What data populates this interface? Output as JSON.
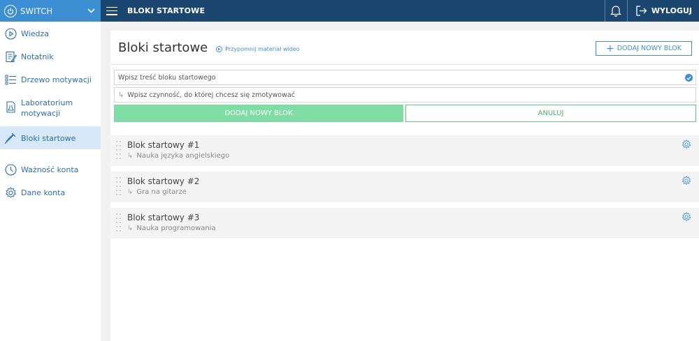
{
  "topbar": {
    "brand": "SWITCH",
    "title": "BLOKI STARTOWE",
    "logout": "WYLOGUJ"
  },
  "sidebar": {
    "items": [
      {
        "label": "Wiedza",
        "icon": "play-circle-icon"
      },
      {
        "label": "Notatnik",
        "icon": "notebook-icon"
      },
      {
        "label": "Drzewo motywacji",
        "icon": "list-tree-icon"
      },
      {
        "label": "Laboratorium motywacji",
        "icon": "lab-document-icon"
      },
      {
        "label": "Bloki startowe",
        "icon": "syringe-icon"
      },
      {
        "label": "Ważność konta",
        "icon": "clock-icon"
      },
      {
        "label": "Dane konta",
        "icon": "gear-icon"
      }
    ]
  },
  "page": {
    "title": "Bloki startowe",
    "video_link": "Przypomnij materiał wideo",
    "add_button": "DODAJ NOWY BLOK"
  },
  "form": {
    "block_placeholder": "Wpisz treść bloku startowego",
    "action_placeholder": "Wpisz czynność, do której chcesz się zmotywować",
    "submit": "DODAJ NOWY BLOK",
    "cancel": "ANULUJ"
  },
  "blocks": [
    {
      "title": "Blok startowy #1",
      "sub": "Nauka języka angielskiego"
    },
    {
      "title": "Blok startowy #2",
      "sub": "Gra na gitarze"
    },
    {
      "title": "Blok startowy #3",
      "sub": "Nauka programowania"
    }
  ],
  "colors": {
    "topbar": "#1a466f",
    "brand": "#3d8fd3",
    "accent": "#3d8fd3",
    "success": "#7fdca5",
    "active_nav": "#d7e8f8"
  }
}
